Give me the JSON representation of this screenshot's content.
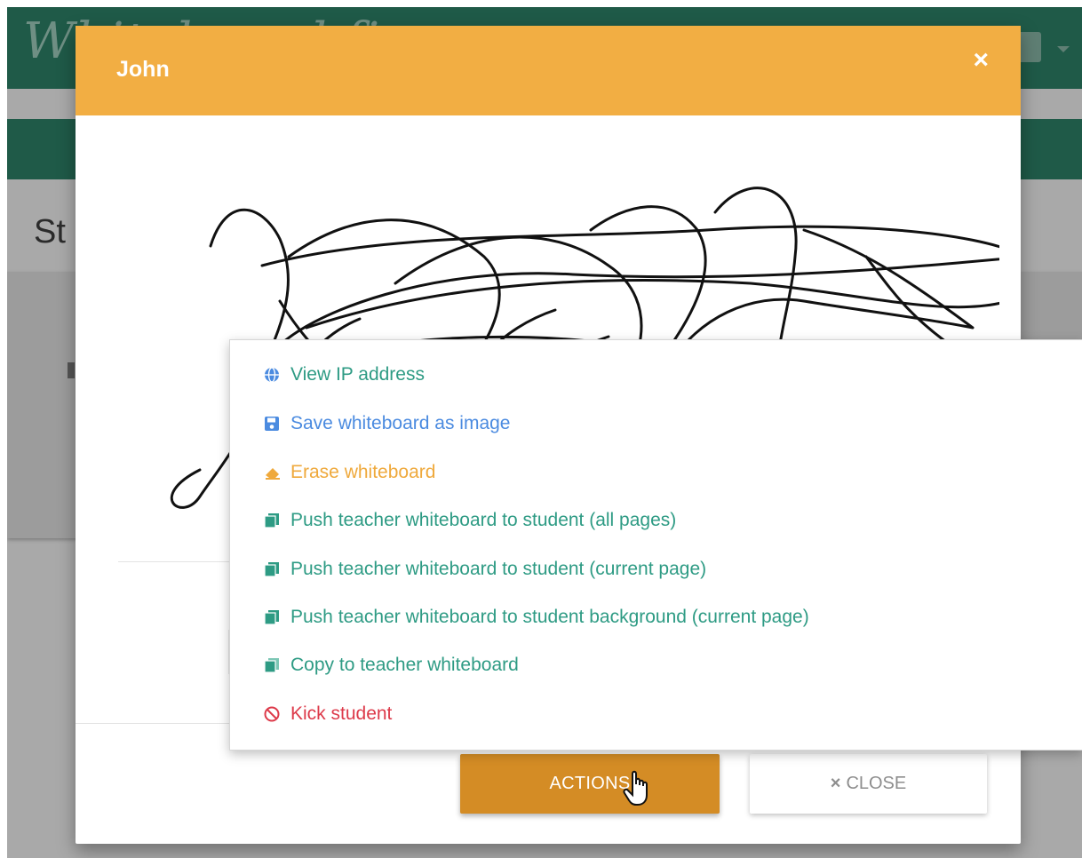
{
  "background": {
    "brand": "Whiteboard.fi",
    "heading": "St"
  },
  "modal": {
    "title": "John",
    "close_icon": "×",
    "actions_button": "ACTIONS",
    "close_button": "CLOSE",
    "close_button_icon": "×"
  },
  "dropdown": {
    "items": [
      {
        "label": "View IP address",
        "icon": "globe-icon",
        "color": "#2e9b84"
      },
      {
        "label": "Save whiteboard as image",
        "icon": "floppy-disk-icon",
        "color": "#4b8be0"
      },
      {
        "label": "Erase whiteboard",
        "icon": "eraser-icon",
        "color": "#efa93c"
      },
      {
        "label": "Push teacher whiteboard to student (all pages)",
        "icon": "copy-icon",
        "color": "#2e9b84"
      },
      {
        "label": "Push teacher whiteboard to student (current page)",
        "icon": "copy-icon",
        "color": "#2e9b84"
      },
      {
        "label": "Push teacher whiteboard to student background (current page)",
        "icon": "copy-icon",
        "color": "#2e9b84"
      },
      {
        "label": "Copy to teacher whiteboard",
        "icon": "copy-icon",
        "color": "#2e9b84"
      },
      {
        "label": "Kick student",
        "icon": "ban-icon",
        "color": "#dd3a4a"
      }
    ]
  },
  "colors": {
    "header": "#f2ae43",
    "actions_button": "#d48c25",
    "navbar": "#1f5a48"
  }
}
